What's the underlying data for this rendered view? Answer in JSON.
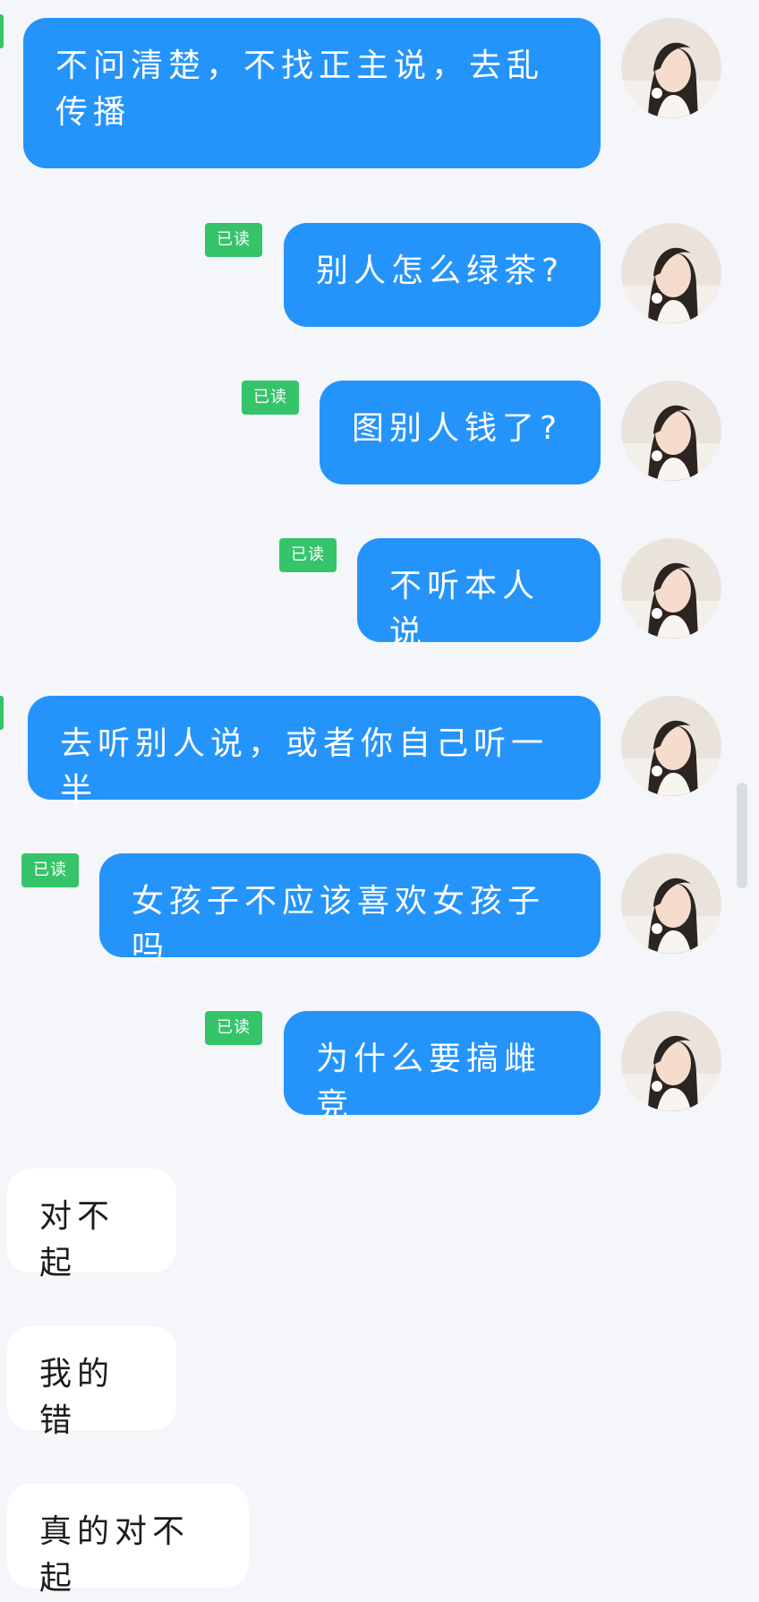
{
  "messages": [
    {
      "dir": "out",
      "text": "不问清楚，不找正主说，去乱传播",
      "read": false
    },
    {
      "dir": "out",
      "text": "别人怎么绿茶?",
      "read": true
    },
    {
      "dir": "out",
      "text": "图别人钱了?",
      "read": true
    },
    {
      "dir": "out",
      "text": "不听本人说",
      "read": true
    },
    {
      "dir": "out",
      "text": "去听别人说，或者你自己听一半",
      "read": false
    },
    {
      "dir": "out",
      "text": "女孩子不应该喜欢女孩子吗",
      "read": true
    },
    {
      "dir": "out",
      "text": "为什么要搞雌竞",
      "read": true
    },
    {
      "dir": "in",
      "text": "对不起"
    },
    {
      "dir": "in",
      "text": "我的错"
    },
    {
      "dir": "in",
      "text": "真的对不起"
    }
  ],
  "read_label": "已读",
  "colors": {
    "outgoing_bubble": "#2494fb",
    "incoming_bubble": "#ffffff",
    "read_badge": "#35c46a",
    "background": "#f4f6f9"
  },
  "avatar": {
    "icon": "avatar-portrait-icon"
  }
}
